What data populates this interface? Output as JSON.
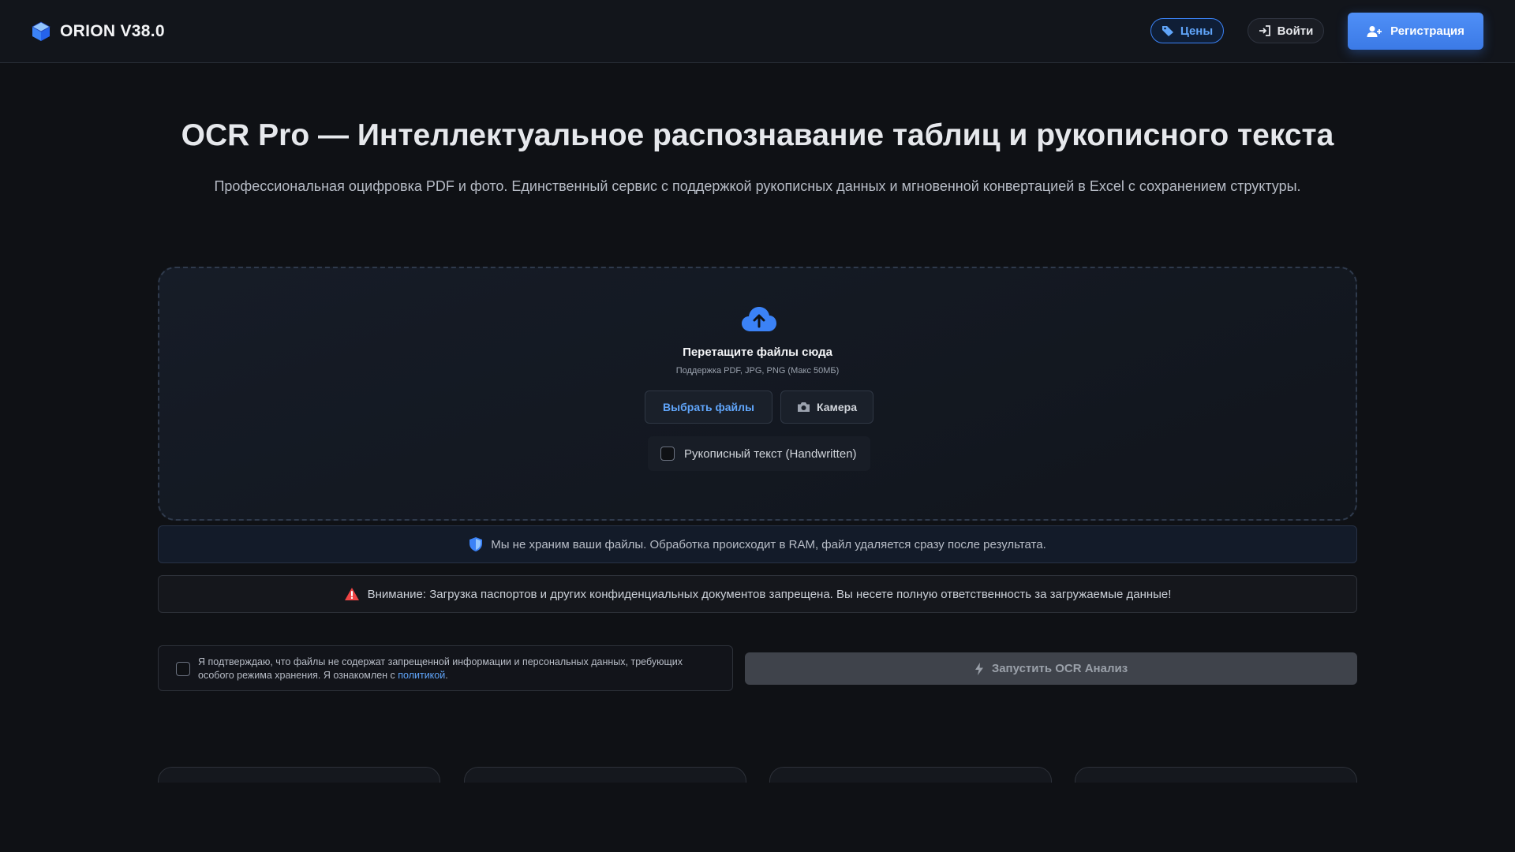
{
  "header": {
    "brand": "ORION V38.0",
    "prices_label": "Цены",
    "login_label": "Войти",
    "register_label": "Регистрация"
  },
  "hero": {
    "title": "OCR Pro — Интеллектуальное распознавание таблиц и рукописного текста",
    "subtitle": "Профессиональная оцифровка PDF и фото. Единственный сервис с поддержкой рукописных данных и мгновенной конвертацией в Excel с сохранением структуры."
  },
  "dropzone": {
    "title": "Перетащите файлы сюда",
    "hint": "Поддержка PDF, JPG, PNG (Макс 50МБ)",
    "choose_label": "Выбрать файлы",
    "camera_label": "Камера",
    "handwritten_label": "Рукописный текст (Handwritten)",
    "handwritten_checked": false
  },
  "notices": {
    "privacy": "Мы не храним ваши файлы. Обработка происходит в RAM, файл удаляется сразу после результата.",
    "warning": "Внимание: Загрузка паспортов и других конфиденциальных документов запрещена. Вы несете полную ответственность за загружаемые данные!"
  },
  "confirm": {
    "text": "Я подтверждаю, что файлы не содержат запрещенной информации и персональных данных, требующих особого режима хранения. Я ознакомлен с ",
    "link_label": "политикой",
    "suffix": ".",
    "checked": false
  },
  "run_button": {
    "label": "Запустить OCR Анализ"
  },
  "colors": {
    "background": "#0f1115",
    "accent": "#3b82f6",
    "warning": "#ef4444"
  },
  "icons": {
    "brand": "cube-icon",
    "prices": "tag-icon",
    "login": "login-icon",
    "register": "user-plus-icon",
    "upload": "cloud-upload-icon",
    "camera": "camera-icon",
    "privacy": "shield-icon",
    "warning": "warning-icon",
    "run": "bolt-icon"
  }
}
